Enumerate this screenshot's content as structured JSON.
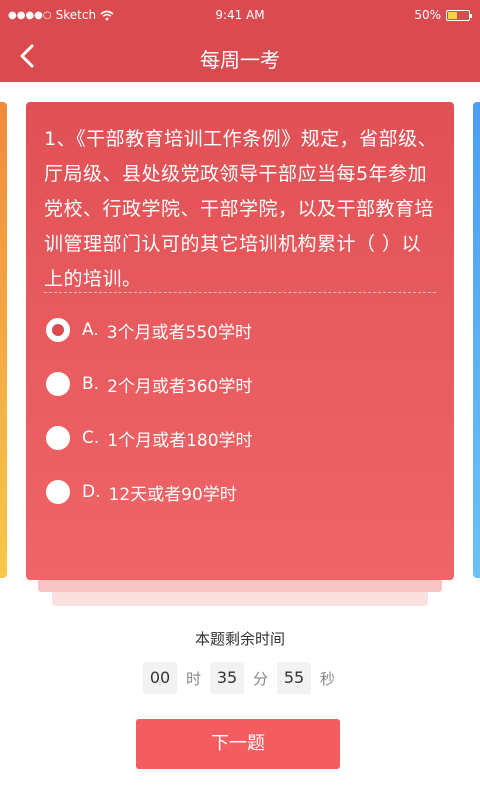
{
  "status_bar": {
    "carrier": "Sketch",
    "signal_dots": "●●●●○",
    "time": "9:41 AM",
    "battery": "50%",
    "battery_level": 0.5
  },
  "nav": {
    "title": "每周一考",
    "back_icon": "chevron-left-icon"
  },
  "question": {
    "text": "1、《干部教育培训工作条例》规定，省部级、厅局级、县处级党政领导干部应当每5年参加党校、行政学院、干部学院，以及干部教育培训管理部门认可的其它培训机构累计（ ）以上的培训。",
    "options": [
      {
        "letter": "A.",
        "text": "3个月或者550学时",
        "selected": true
      },
      {
        "letter": "B.",
        "text": "2个月或者360学时",
        "selected": false
      },
      {
        "letter": "C.",
        "text": "1个月或者180学时",
        "selected": false
      },
      {
        "letter": "D.",
        "text": "12天或者90学时",
        "selected": false
      }
    ]
  },
  "timer": {
    "label": "本题剩余时间",
    "hours": "00",
    "hours_unit": "时",
    "minutes": "35",
    "minutes_unit": "分",
    "seconds": "55",
    "seconds_unit": "秒"
  },
  "next_button": "下一题",
  "colors": {
    "primary": "#d94b4e",
    "button": "#f35d5f"
  }
}
